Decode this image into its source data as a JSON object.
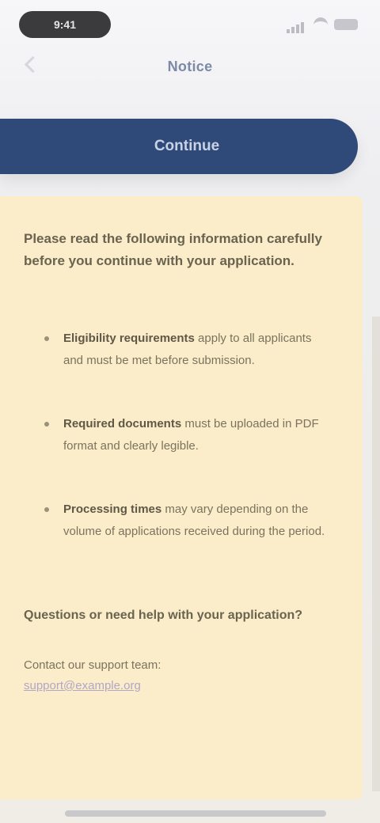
{
  "status_bar": {
    "time": "9:41"
  },
  "header": {
    "title": "Notice"
  },
  "primary_button": {
    "label": "Continue"
  },
  "notice": {
    "intro": "Please read the following information carefully before you continue with your application.",
    "items": [
      {
        "lead": "Eligibility requirements",
        "text": " apply to all applicants and must be met before submission."
      },
      {
        "lead": "Required documents",
        "text": " must be uploaded in PDF format and clearly legible."
      },
      {
        "lead": "Processing times",
        "text": " may vary depending on the volume of applications received during the period."
      }
    ],
    "question": "Questions or need help with your application?",
    "contact_text": "Contact our support team:",
    "contact_link": "support@example.org"
  },
  "icons": {
    "signal": "signal-icon",
    "wifi": "wifi-icon",
    "battery": "battery-icon",
    "back": "back-icon"
  }
}
